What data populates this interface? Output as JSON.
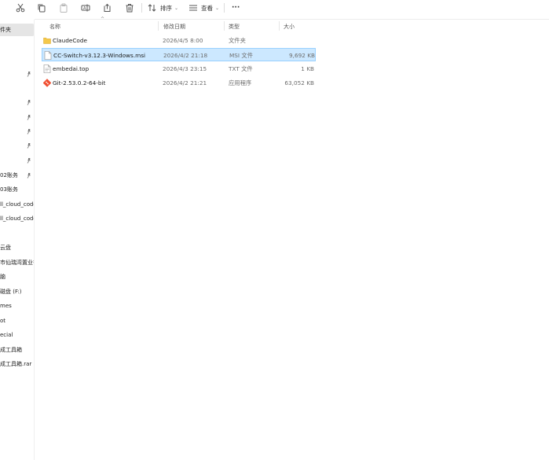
{
  "toolbar": {
    "sort_label": "排序",
    "view_label": "查看",
    "more_label": "···"
  },
  "columns": {
    "name": "名称",
    "date": "修改日期",
    "type": "类型",
    "size": "大小"
  },
  "sidebar": {
    "items": [
      {
        "label": "件夹",
        "selected": true,
        "pinned": false
      },
      {
        "label": "",
        "pinned": true
      },
      {
        "label": "",
        "pinned": true
      },
      {
        "label": "",
        "pinned": true
      },
      {
        "label": "",
        "pinned": true
      },
      {
        "label": "",
        "pinned": true
      },
      {
        "label": "",
        "pinned": true
      },
      {
        "label": "02账务",
        "pinned": true
      },
      {
        "label": "03账务",
        "pinned": false
      },
      {
        "label": "ll_cloud_code",
        "pinned": false
      },
      {
        "label": "ll_cloud_code",
        "pinned": false
      },
      {
        "label": "云盘",
        "pinned": false
      },
      {
        "label": "市仙瑞湾置业有",
        "pinned": false
      },
      {
        "label": "脑",
        "pinned": false
      },
      {
        "label": "磁盘 (F:)",
        "pinned": false
      },
      {
        "label": "mes",
        "pinned": false
      },
      {
        "label": "ot",
        "pinned": false
      },
      {
        "label": "ecial",
        "pinned": false
      },
      {
        "label": "成工具箱",
        "pinned": false
      },
      {
        "label": "成工具箱.rar",
        "pinned": false
      }
    ]
  },
  "files": [
    {
      "name": "ClaudeCode",
      "date": "2026/4/5 8:00",
      "type": "文件夹",
      "size": "",
      "icon": "folder-icon"
    },
    {
      "name": "CC-Switch-v3.12.3-Windows.msi",
      "date": "2026/4/2 21:18",
      "type": "MSI 文件",
      "size": "9,692 KB",
      "icon": "msi-file-icon",
      "selected": true
    },
    {
      "name": "embedai.top",
      "date": "2026/4/3 23:15",
      "type": "TXT 文件",
      "size": "1 KB",
      "icon": "text-file-icon"
    },
    {
      "name": "Git-2.53.0.2-64-bit",
      "date": "2026/4/2 21:21",
      "type": "应用程序",
      "size": "63,052 KB",
      "icon": "git-app-icon"
    }
  ],
  "colors": {
    "selection_bg": "#cce8ff",
    "selection_border": "#99d1ff",
    "folder": "#f4c84b",
    "git": "#f05032"
  }
}
